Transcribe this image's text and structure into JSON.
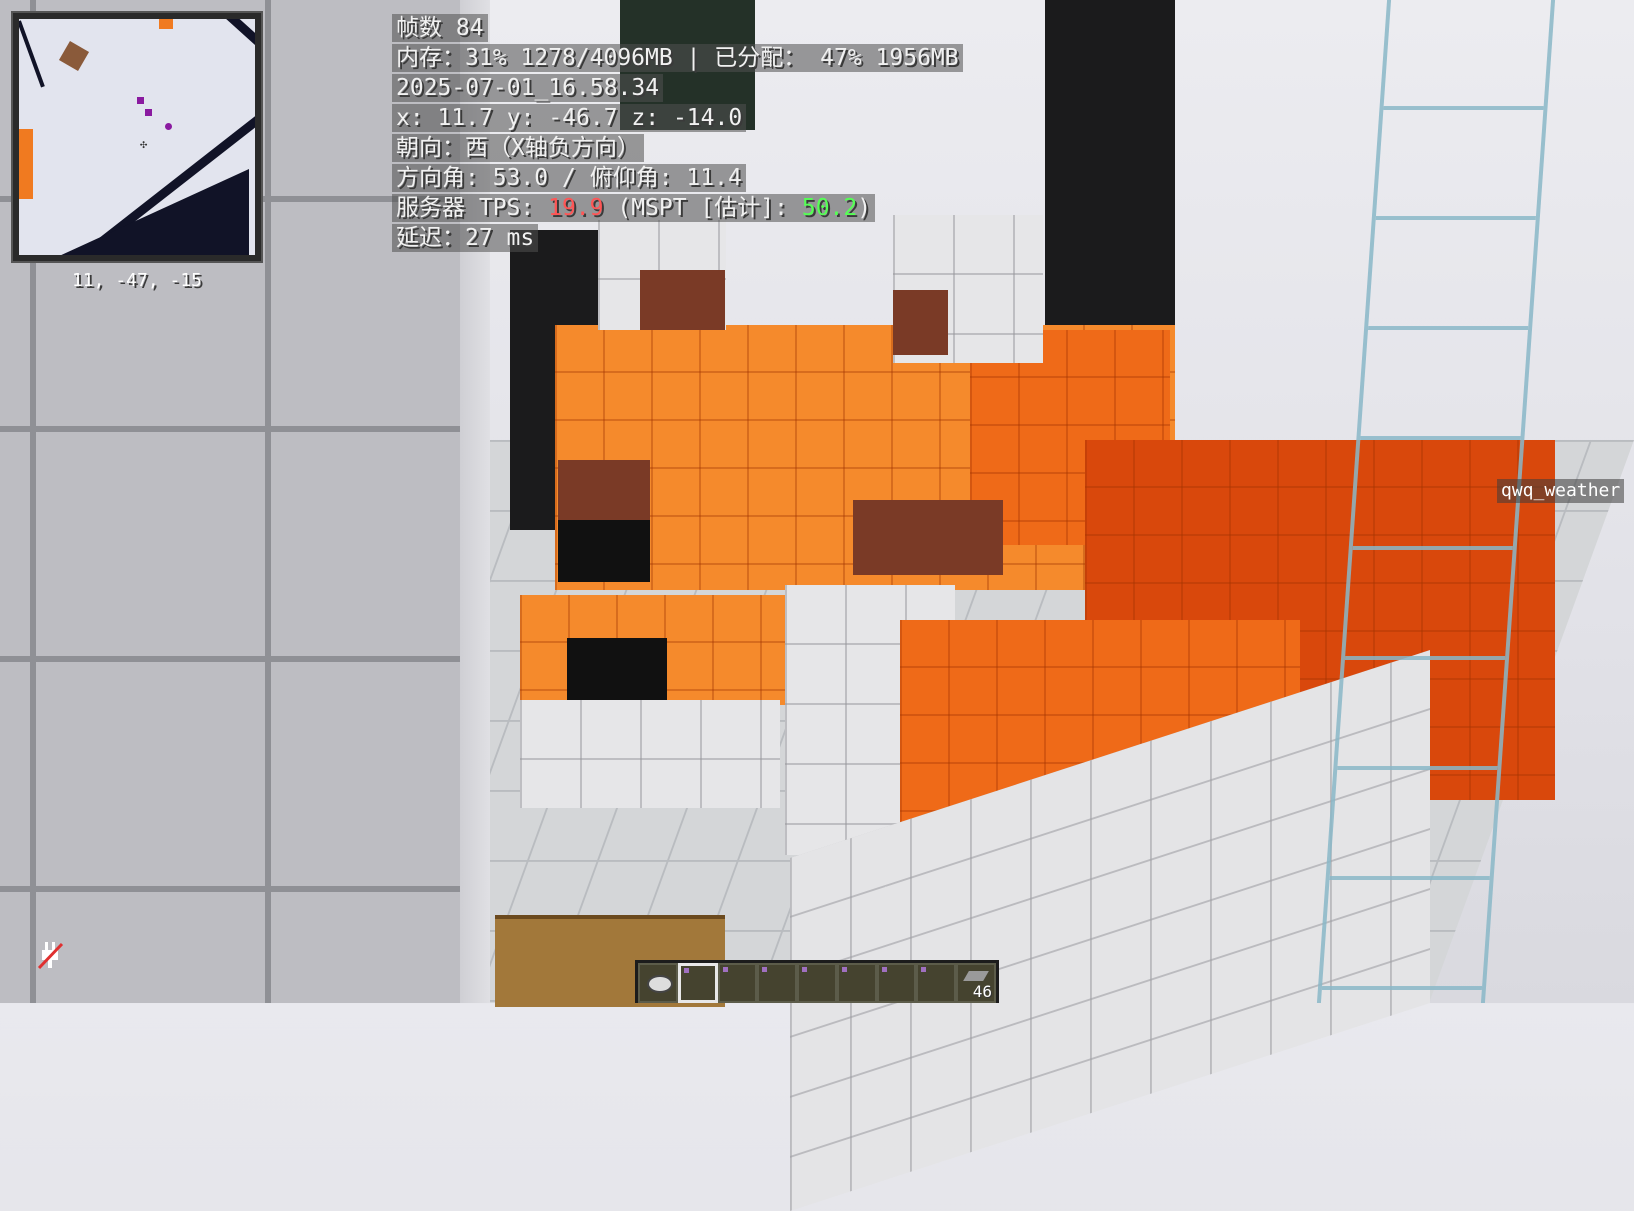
{
  "debug": {
    "fps_label": "帧数",
    "fps_value": "84",
    "memory_label": "内存：",
    "memory_value": "31% 1278/4096MB",
    "separator": "|",
    "allocated_label": "已分配：",
    "allocated_value": "47% 1956MB",
    "timestamp": "2025-07-01_16.58.34",
    "position": "x: 11.7 y: -46.7 z: -14.0",
    "facing_label": "朝向：",
    "facing_value": "西（X轴负方向）",
    "yaw_label": "方向角:",
    "yaw_value": "53.0",
    "angle_separator": "/",
    "pitch_label": "俯仰角:",
    "pitch_value": "11.4",
    "server_label": "服务器 TPS:",
    "tps_value": "19.9",
    "mspt_label": "(MSPT [估计]:",
    "mspt_value": "50.2",
    "mspt_close": ")",
    "latency_label": "延迟：",
    "latency_value": "27 ms"
  },
  "minimap": {
    "coords": "11, -47, -15"
  },
  "player": {
    "nametag": "qwq_weather"
  },
  "hotbar": {
    "selected_slot": 2,
    "last_slot_count": "46"
  },
  "colors": {
    "tps": "#ff5555",
    "mspt": "#55ff55"
  },
  "icons": {
    "ping": "no-connection-plug-icon",
    "compass": "compass-icon",
    "directional": "compass-crosshair-icon"
  }
}
